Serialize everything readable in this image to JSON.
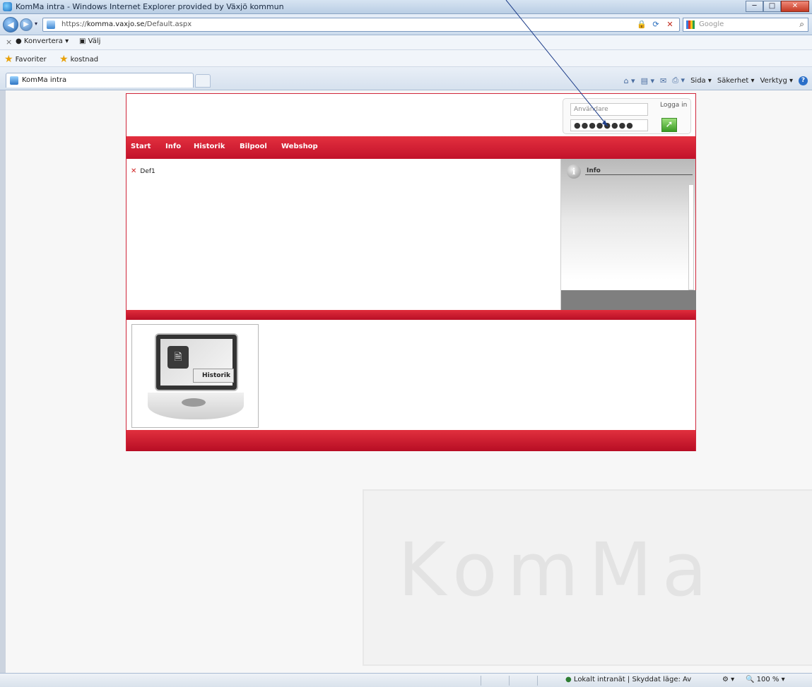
{
  "window": {
    "title": "KomMa intra - Windows Internet Explorer provided by Växjö kommun",
    "buttons": {
      "minimize": "─",
      "maximize": "□",
      "close": "✕"
    }
  },
  "addressbar": {
    "url_prefix": "https://",
    "url_domain": "komma.vaxjo.se",
    "url_path": "/Default.aspx",
    "search_placeholder": "Google"
  },
  "commandbar": {
    "items": [
      "Konvertera",
      "Välj"
    ]
  },
  "favorites": {
    "items": [
      "Favoriter",
      "kostnad"
    ]
  },
  "tab": {
    "label": "KomMa intra"
  },
  "tools": {
    "sida": "Sida ▾",
    "sakerhet": "Säkerhet ▾",
    "verktyg": "Verktyg ▾"
  },
  "site": {
    "login": {
      "username_placeholder": "Användare",
      "password_value": "●●●●●●●●",
      "button_label": "Logga in"
    },
    "nav": [
      "Start",
      "Info",
      "Historik",
      "Bilpool",
      "Webshop"
    ],
    "content_item": "Def1",
    "info_title": "Info",
    "tile_label": "Historik"
  },
  "background": {
    "watermark": "KomMa"
  },
  "statusbar": {
    "zone": "Lokalt intranät | Skyddat läge: Av",
    "zoom": "100 %"
  }
}
